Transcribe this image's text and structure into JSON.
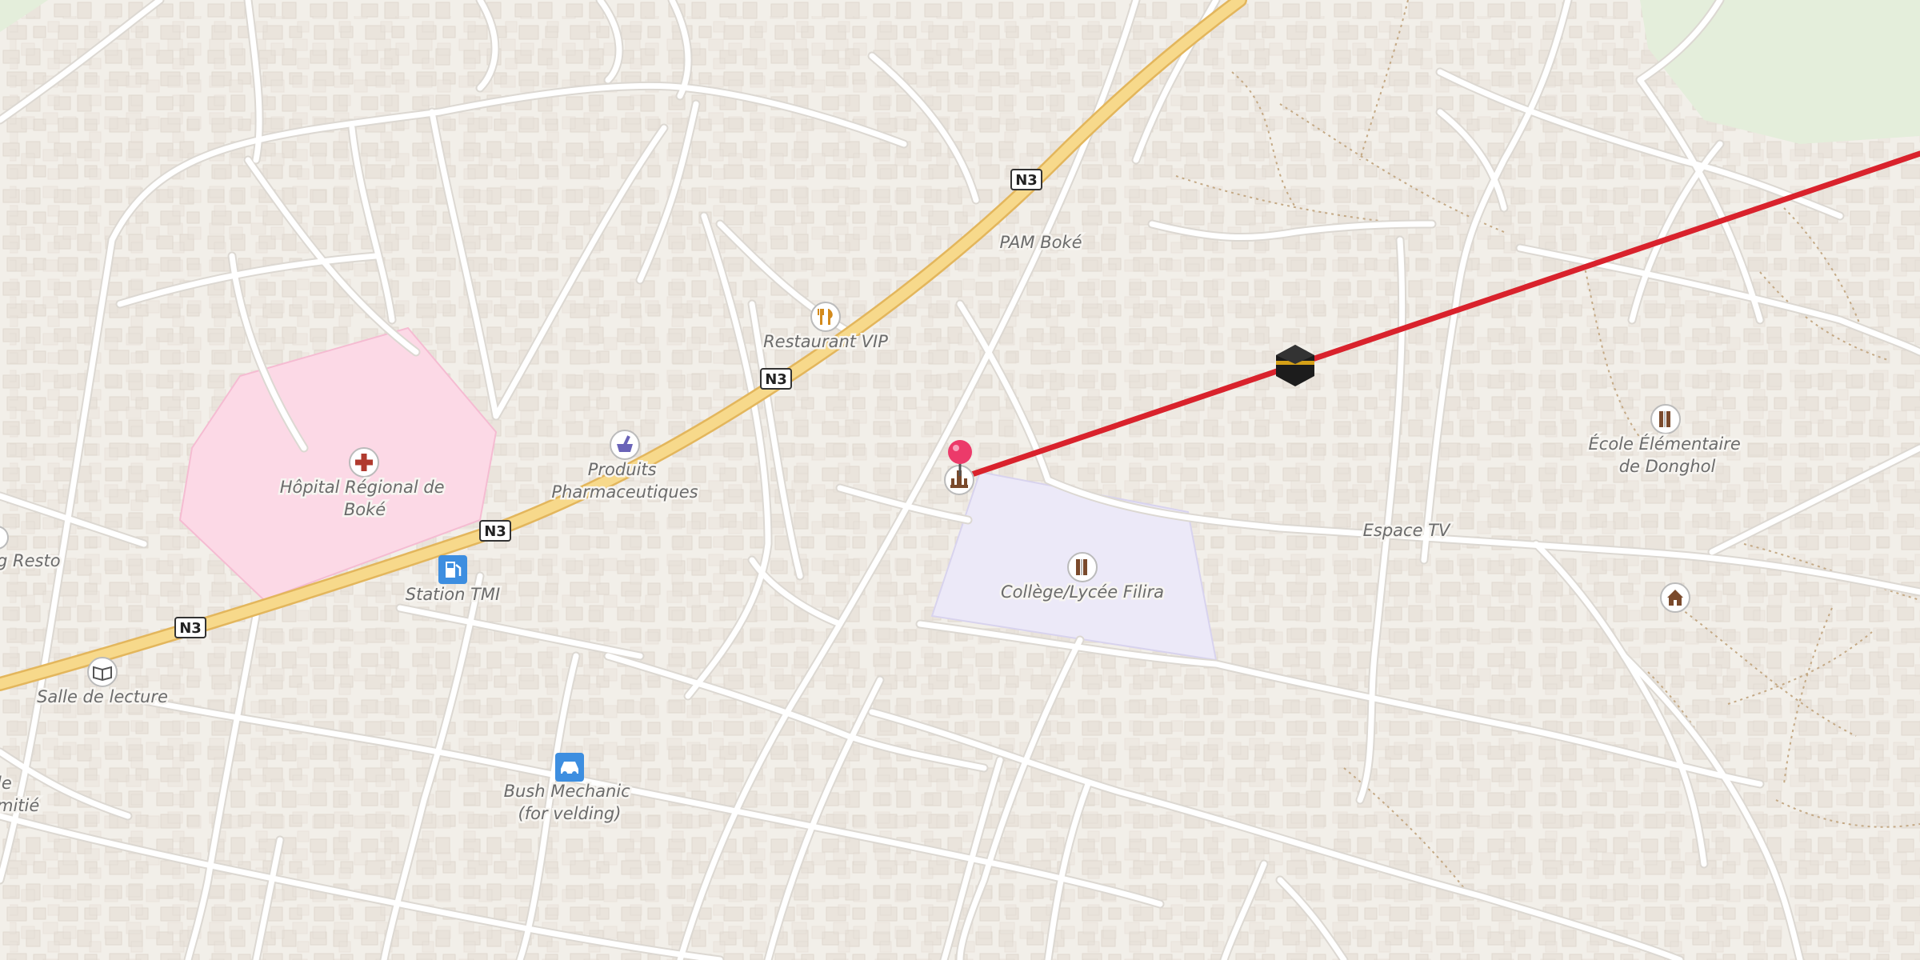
{
  "map": {
    "roads": {
      "highway_shield": "N3"
    },
    "places": {
      "hospital": "Hôpital Régional de Boké",
      "restaurant": "Restaurant VIP",
      "pharmacy": "Produits Pharmaceutiques",
      "fuel": "Station TMI",
      "mechanic": "Bush Mechanic (for velding)",
      "reading_room": "Salle de lecture",
      "college": "Collège/Lycée Filira",
      "school": "École Élémentaire de Donghol",
      "pam": "PAM Boké",
      "espace_tv": "Espace TV",
      "resto_partial": "g Resto",
      "amitie_partial_1": "le",
      "amitie_partial_2": "mitié"
    },
    "icons": {
      "hospital": "hospital-cross-icon",
      "restaurant": "fork-knife-icon",
      "pharmacy": "mortar-pestle-icon",
      "fuel": "fuel-pump-icon",
      "mechanic": "car-icon",
      "reading_room": "book-icon",
      "college": "school-icon",
      "school": "school-icon",
      "mosque": "kaaba-icon",
      "monument": "monument-icon",
      "pin": "location-pin-icon",
      "shelter": "hut-icon"
    },
    "colors": {
      "background": "#f2efe9",
      "road": "#ffffff",
      "road_casing": "#dcd8d2",
      "highway": "#f7d98b",
      "highway_casing": "#e3b65c",
      "hospital_area": "#fcd9e6",
      "school_area": "#ece9f8",
      "park_area": "#e4eedb",
      "building": "#e8e2da",
      "route_line": "#d9222c",
      "pin": "#ec3a6a",
      "footpath": "#c4a985"
    }
  }
}
